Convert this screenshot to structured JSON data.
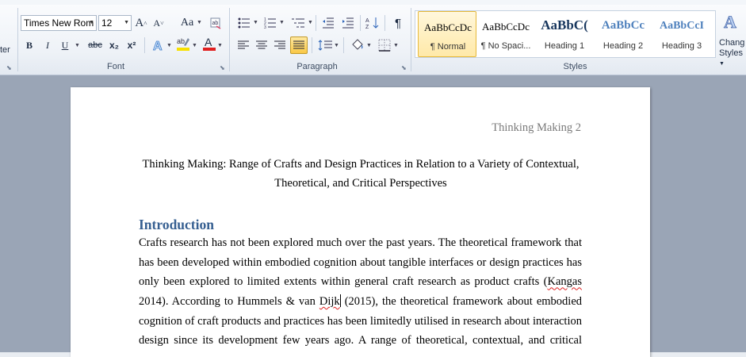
{
  "ribbon": {
    "clipboard_partial_label": "ter",
    "font": {
      "group_label": "Font",
      "font_name": "Times New Rom",
      "font_size": "12",
      "grow_label": "A",
      "shrink_label": "A",
      "change_case_label": "Aa",
      "bold": "B",
      "italic": "I",
      "underline": "U",
      "strikethrough": "abc",
      "subscript": "x₂",
      "superscript": "x²",
      "font_color_label": "A"
    },
    "paragraph": {
      "group_label": "Paragraph",
      "show_marks_label": "¶"
    },
    "styles": {
      "group_label": "Styles",
      "items": [
        {
          "sample": "AaBbCcDc",
          "name": "¶ Normal"
        },
        {
          "sample": "AaBbCcDc",
          "name": "¶ No Spaci..."
        },
        {
          "sample": "AaBbC(",
          "name": "Heading 1"
        },
        {
          "sample": "AaBbCc",
          "name": "Heading 2"
        },
        {
          "sample": "AaBbCcI",
          "name": "Heading 3"
        }
      ],
      "change_styles_line1": "Chang",
      "change_styles_line2": "Styles"
    }
  },
  "document": {
    "header": "Thinking Making 2",
    "title_line1": "Thinking Making: Range of Crafts and Design Practices in Relation to a Variety of Contextual,",
    "title_line2": "Theoretical, and Critical Perspectives",
    "heading": "Introduction",
    "lines": [
      "Crafts research has not been explored much over the past years. The theoretical framework that",
      "has been developed within embodied cognition about tangible interfaces or design practices has",
      "only been explored to limited extents within general craft research as product crafts (",
      "2014). According to Hummels & van ",
      "cognition of craft products and practices has been limitedly utilised in research about interaction",
      "design since its development few years ago. A range of theoretical, contextual, and critical"
    ],
    "kangas": "Kangas",
    "dijk": "Dijk",
    "after_dijk": " (2015), the theoretical framework about embodied"
  },
  "colors": {
    "heading": "#365f91",
    "header_text": "#7a7a7a",
    "spell_error": "#e02020",
    "font_color_bar": "#e02020",
    "highlight_bar": "#f7e000"
  }
}
